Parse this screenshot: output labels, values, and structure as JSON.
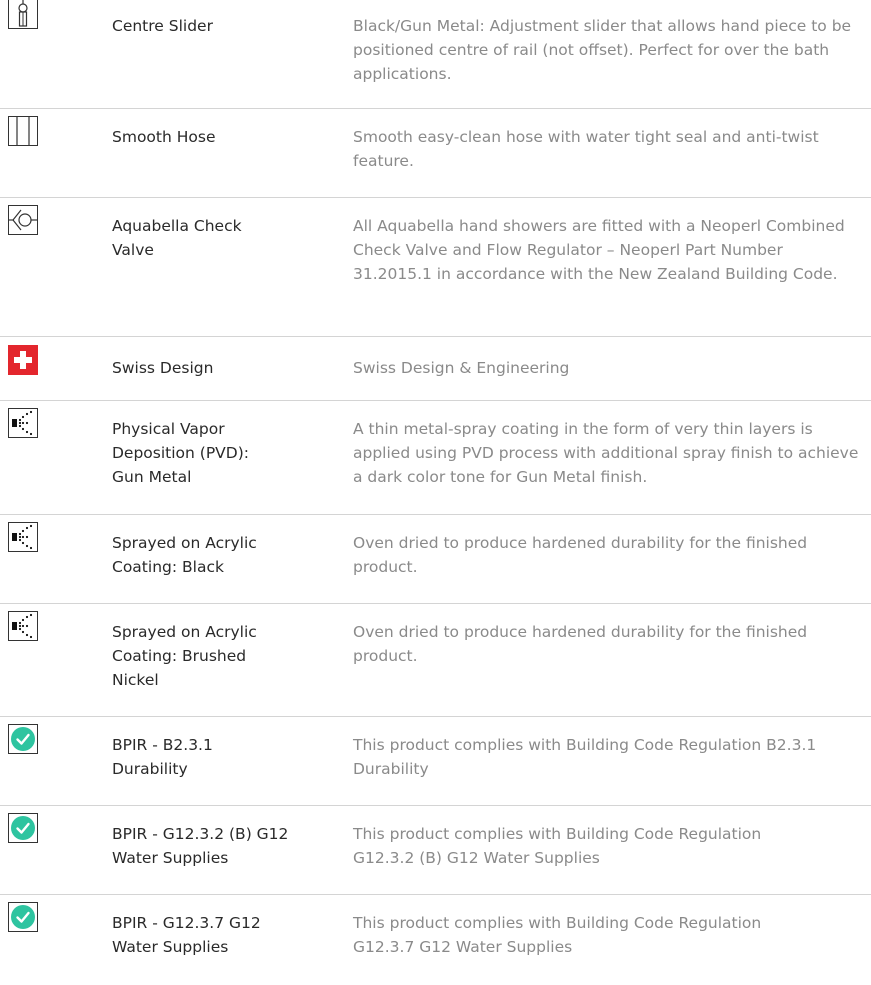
{
  "features": [
    {
      "icon": "centre-slider-icon",
      "name": "Centre Slider",
      "description": "Black/Gun Metal: Adjustment slider that allows hand piece to be positioned centre of rail (not offset). Perfect for over the bath applications."
    },
    {
      "icon": "smooth-hose-icon",
      "name": "Smooth Hose",
      "description": "Smooth easy-clean hose with water tight seal and anti-twist feature."
    },
    {
      "icon": "check-valve-icon",
      "name": "Aquabella Check Valve",
      "description": "All Aquabella hand showers are fitted with a Neoperl Combined Check Valve and Flow Regulator – Neoperl Part Number 31.2015.1 in accordance with the New Zealand Building Code."
    },
    {
      "icon": "swiss-flag-icon",
      "name": "Swiss Design",
      "description": "Swiss Design & Engineering"
    },
    {
      "icon": "spray-coating-icon",
      "name": "Physical Vapor Deposition (PVD): Gun Metal",
      "description": "A thin metal-spray coating in the form of very thin layers is applied using PVD process with additional spray finish to achieve a dark color tone for Gun Metal finish."
    },
    {
      "icon": "spray-coating-icon",
      "name": "Sprayed on Acrylic Coating: Black",
      "description": "Oven dried to produce hardened durability for the finished product."
    },
    {
      "icon": "spray-coating-icon",
      "name": "Sprayed on Acrylic Coating: Brushed Nickel",
      "description": "Oven dried to produce hardened durability for the finished product."
    },
    {
      "icon": "checkmark-circle-icon",
      "name": "BPIR - B2.3.1 Durability",
      "description": "This product complies with Building Code Regulation B2.3.1 Durability"
    },
    {
      "icon": "checkmark-circle-icon",
      "name": "BPIR - G12.3.2 (B) G12 Water Supplies",
      "description": "This product complies with Building Code Regulation G12.3.2 (B) G12 Water Supplies"
    },
    {
      "icon": "checkmark-circle-icon",
      "name": "BPIR - G12.3.7 G12 Water Supplies",
      "description": "This product complies with Building Code Regulation G12.3.7 G12 Water Supplies"
    }
  ],
  "colors": {
    "swiss_red": "#e3262d",
    "check_teal": "#2ec4a0",
    "divider": "#d4d4d4",
    "name_text": "#2a2a2a",
    "desc_text": "#8a8a8a"
  }
}
